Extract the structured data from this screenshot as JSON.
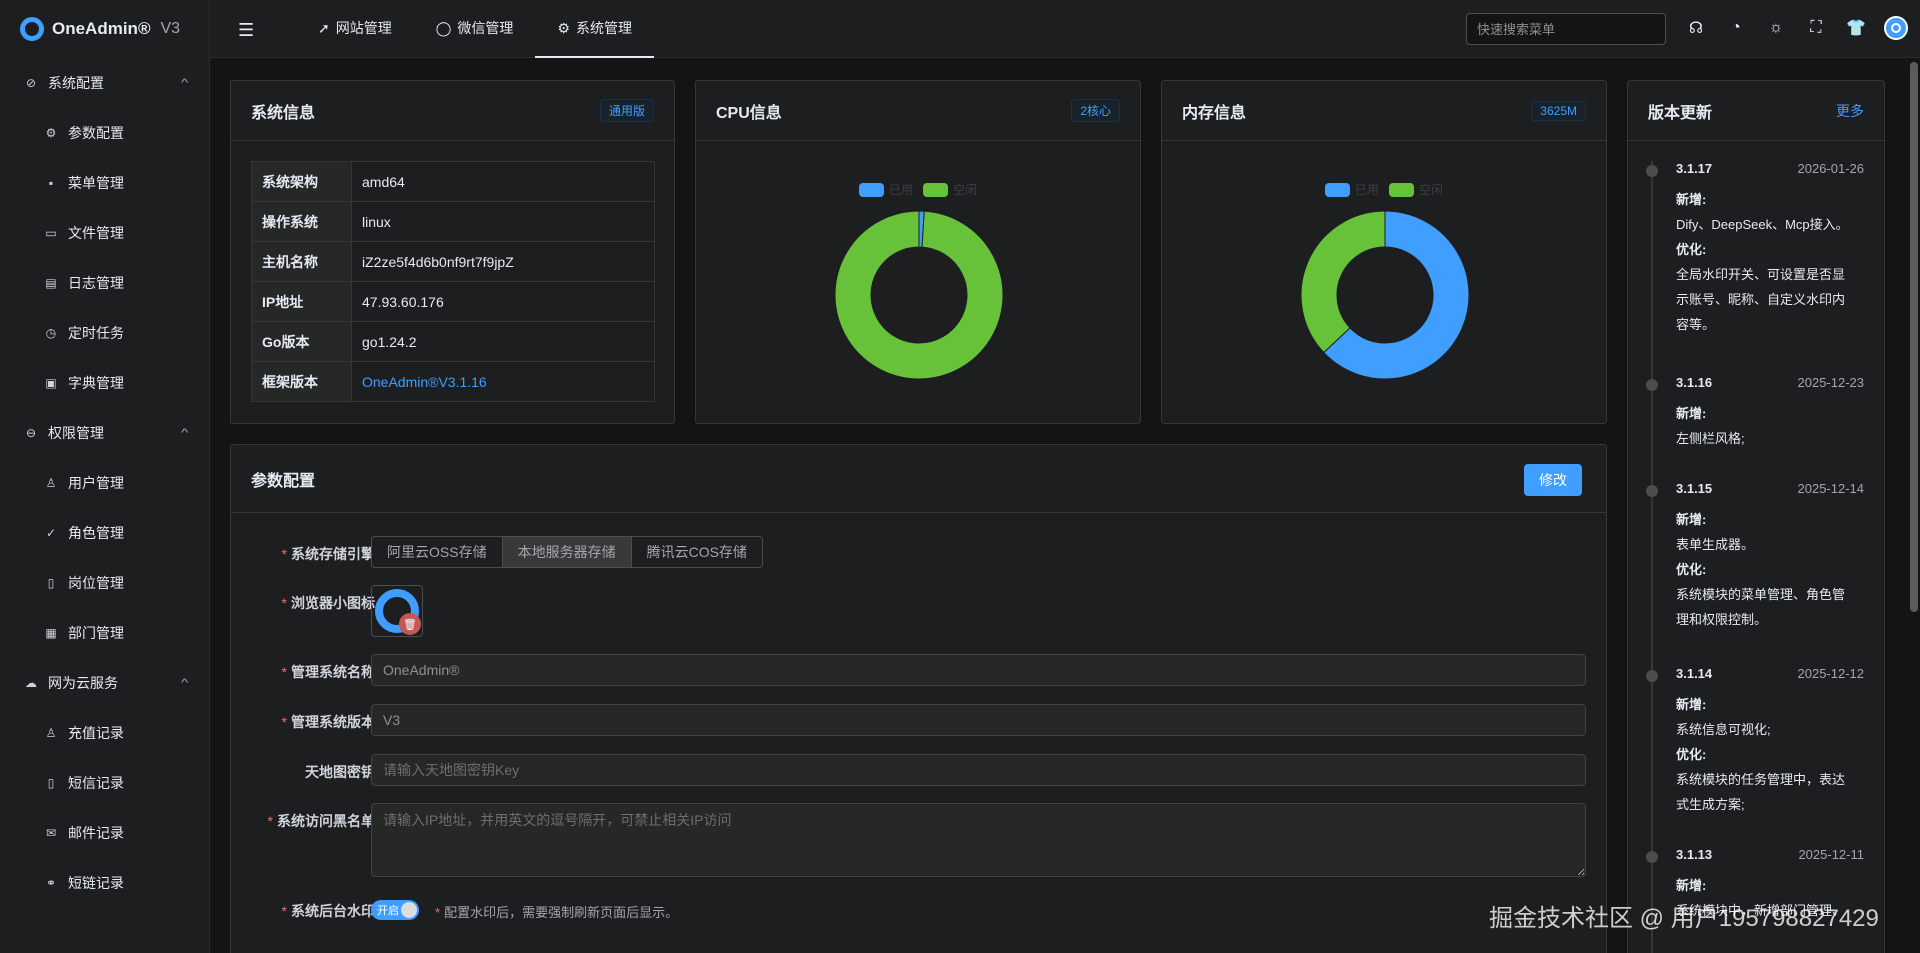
{
  "app": {
    "name": "OneAdmin®",
    "version": "V3"
  },
  "sidebar": {
    "groups": [
      {
        "label": "系统配置",
        "icon": "settings-icon",
        "items": [
          {
            "label": "参数配置",
            "icon": "gear-icon"
          },
          {
            "label": "菜单管理",
            "icon": "grid-icon"
          },
          {
            "label": "文件管理",
            "icon": "folder-icon"
          },
          {
            "label": "日志管理",
            "icon": "document-icon"
          },
          {
            "label": "定时任务",
            "icon": "timer-icon"
          },
          {
            "label": "字典管理",
            "icon": "book-icon"
          }
        ]
      },
      {
        "label": "权限管理",
        "icon": "lock-icon",
        "items": [
          {
            "label": "用户管理",
            "icon": "user-icon"
          },
          {
            "label": "角色管理",
            "icon": "check-circle-icon"
          },
          {
            "label": "岗位管理",
            "icon": "notebook-icon"
          },
          {
            "label": "部门管理",
            "icon": "building-icon"
          }
        ]
      },
      {
        "label": "网为云服务",
        "icon": "cloud-icon",
        "items": [
          {
            "label": "充值记录",
            "icon": "user-icon"
          },
          {
            "label": "短信记录",
            "icon": "phone-icon"
          },
          {
            "label": "邮件记录",
            "icon": "mail-icon"
          },
          {
            "label": "短链记录",
            "icon": "link-icon"
          }
        ]
      }
    ]
  },
  "header": {
    "tabs": [
      {
        "label": "网站管理",
        "icon": "send-icon"
      },
      {
        "label": "微信管理",
        "icon": "chat-icon"
      },
      {
        "label": "系统管理",
        "icon": "gear-icon"
      }
    ],
    "active_tab": "系统管理",
    "search_placeholder": "快速搜索菜单",
    "icons": [
      "headset-icon",
      "palette-icon",
      "sun-icon",
      "fullscreen-icon",
      "shirt-icon",
      "avatar"
    ]
  },
  "system_info": {
    "title": "系统信息",
    "tag": "通用版",
    "rows": [
      {
        "key": "系统架构",
        "value": "amd64"
      },
      {
        "key": "操作系统",
        "value": "linux"
      },
      {
        "key": "主机名称",
        "value": "iZ2ze5f4d6b0nf9rt7f9jpZ"
      },
      {
        "key": "IP地址",
        "value": "47.93.60.176"
      },
      {
        "key": "Go版本",
        "value": "go1.24.2"
      },
      {
        "key": "框架版本",
        "value": "OneAdmin®V3.1.16"
      }
    ]
  },
  "cpu_info": {
    "title": "CPU信息",
    "tag": "2核心"
  },
  "mem_info": {
    "title": "内存信息",
    "tag": "3625M"
  },
  "chart_data": [
    {
      "type": "pie",
      "title": "",
      "legend": [
        "已用",
        "空闲"
      ],
      "legend_position": "top-center",
      "colors": [
        "#409eff",
        "#67c23a"
      ],
      "values": [
        1,
        99
      ]
    },
    {
      "type": "pie",
      "title": "",
      "legend": [
        "已用",
        "空闲"
      ],
      "legend_position": "top-center",
      "colors": [
        "#409eff",
        "#67c23a"
      ],
      "values": [
        63,
        37
      ]
    }
  ],
  "params": {
    "title": "参数配置",
    "edit_label": "修改",
    "storage": {
      "label": "系统存储引擎",
      "options": [
        "阿里云OSS存储",
        "本地服务器存储",
        "腾讯云COS存储"
      ],
      "selected": "本地服务器存储"
    },
    "favicon_label": "浏览器小图标",
    "sys_name": {
      "label": "管理系统名称",
      "value": "OneAdmin®"
    },
    "sys_version": {
      "label": "管理系统版本",
      "value": "V3"
    },
    "map_key": {
      "label": "天地图密钥",
      "placeholder": "请输入天地图密钥Key"
    },
    "blacklist": {
      "label": "系统访问黑名单",
      "placeholder": "请输入IP地址，并用英文的逗号隔开，可禁止相关IP访问"
    },
    "watermark": {
      "label": "系统后台水印",
      "toggle_text": "开启",
      "hint": "配置水印后，需要强制刷新页面后显示。"
    }
  },
  "updates": {
    "title": "版本更新",
    "more": "更多",
    "entries": [
      {
        "version": "3.1.17",
        "date": "2026-01-26",
        "lines": [
          "新增:",
          "Dify、DeepSeek、Mcp接入。",
          "优化:",
          "全局水印开关、可设置是否显",
          "示账号、昵称、自定义水印内",
          "容等。"
        ]
      },
      {
        "version": "3.1.16",
        "date": "2025-12-23",
        "lines": [
          "新增:",
          "左侧栏风格;"
        ]
      },
      {
        "version": "3.1.15",
        "date": "2025-12-14",
        "lines": [
          "新增:",
          "表单生成器。",
          "优化:",
          "系统模块的菜单管理、角色管",
          "理和权限控制。"
        ]
      },
      {
        "version": "3.1.14",
        "date": "2025-12-12",
        "lines": [
          "新增:",
          "系统信息可视化;",
          "优化:",
          "系统模块的任务管理中，表达",
          "式生成方案;"
        ]
      },
      {
        "version": "3.1.13",
        "date": "2025-12-11",
        "lines": [
          "新增:",
          "系统模块中，新增部门管理、"
        ]
      }
    ]
  },
  "watermark_text": "掘金技术社区 @ 用户195798827429"
}
